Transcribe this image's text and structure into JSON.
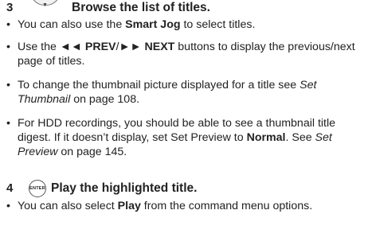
{
  "step3": {
    "number": "3",
    "title": "Browse the list of titles.",
    "bullets": [
      {
        "pre": "You can also use the ",
        "b1": "Smart Jog",
        "post": " to select titles."
      },
      {
        "sym1": "◄◄",
        "b1": " PREV",
        "mid": "/",
        "sym2": "►►",
        "b2": " NEXT",
        "post": " buttons to display the previous/next page of titles."
      },
      {
        "pre": "To change the thumbnail picture displayed for a title see ",
        "i1": "Set Thumbnail",
        "post": " on page 108."
      },
      {
        "pre": "For HDD recordings, you should be able to see a thumbnail title digest. If it doesn’t display, set Set Preview to ",
        "b1": "Normal",
        "mid": ". See ",
        "i1": "Set Preview",
        "post": " on page 145."
      }
    ]
  },
  "step4": {
    "number": "4",
    "icon_label": "ENTER",
    "title": "Play the highlighted title.",
    "bullets": [
      {
        "pre": "You can also select ",
        "b1": "Play",
        "post": " from the command menu options."
      }
    ]
  },
  "bullet_char": "•"
}
